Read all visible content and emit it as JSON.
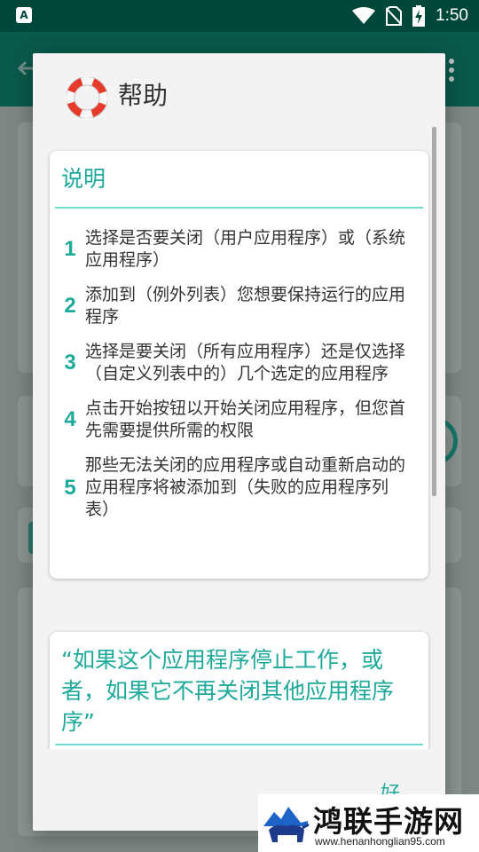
{
  "status_bar": {
    "time": "1:50",
    "notification_glyph": "A"
  },
  "dialog": {
    "title": "帮助",
    "card_instructions": {
      "title": "说明",
      "steps": [
        {
          "num": "1",
          "text": "选择是否要关闭（用户应用程序）或（系统应用程序）"
        },
        {
          "num": "2",
          "text": "添加到（例外列表）您想要保持运行的应用程序"
        },
        {
          "num": "3",
          "text": "选择是要关闭（所有应用程序）还是仅选择（自定义列表中的）几个选定的应用程序"
        },
        {
          "num": "4",
          "text": "点击开始按钮以开始关闭应用程序，但您首先需要提供所需的权限"
        },
        {
          "num": "5",
          "text": "那些无法关闭的应用程序或自动重新启动的应用程序将被添加到（失败的应用程序列表）"
        }
      ]
    },
    "card_faq": {
      "question": "“如果这个应用程序停止工作，或者，如果它不再关闭其他应用程序序”"
    },
    "ok_label": "好"
  },
  "watermark": {
    "title": "鸿联手游网",
    "url": "www.henanhonglian95.com"
  },
  "colors": {
    "accent": "#1eaa9a",
    "status_bar": "#00473b",
    "dialog_bg": "#f3f3f3"
  },
  "icons": {
    "notification": "a-notification-icon",
    "wifi": "wifi-icon",
    "no_sim": "no-sim-icon",
    "battery": "battery-charging-icon",
    "lifebuoy": "lifebuoy-icon"
  }
}
